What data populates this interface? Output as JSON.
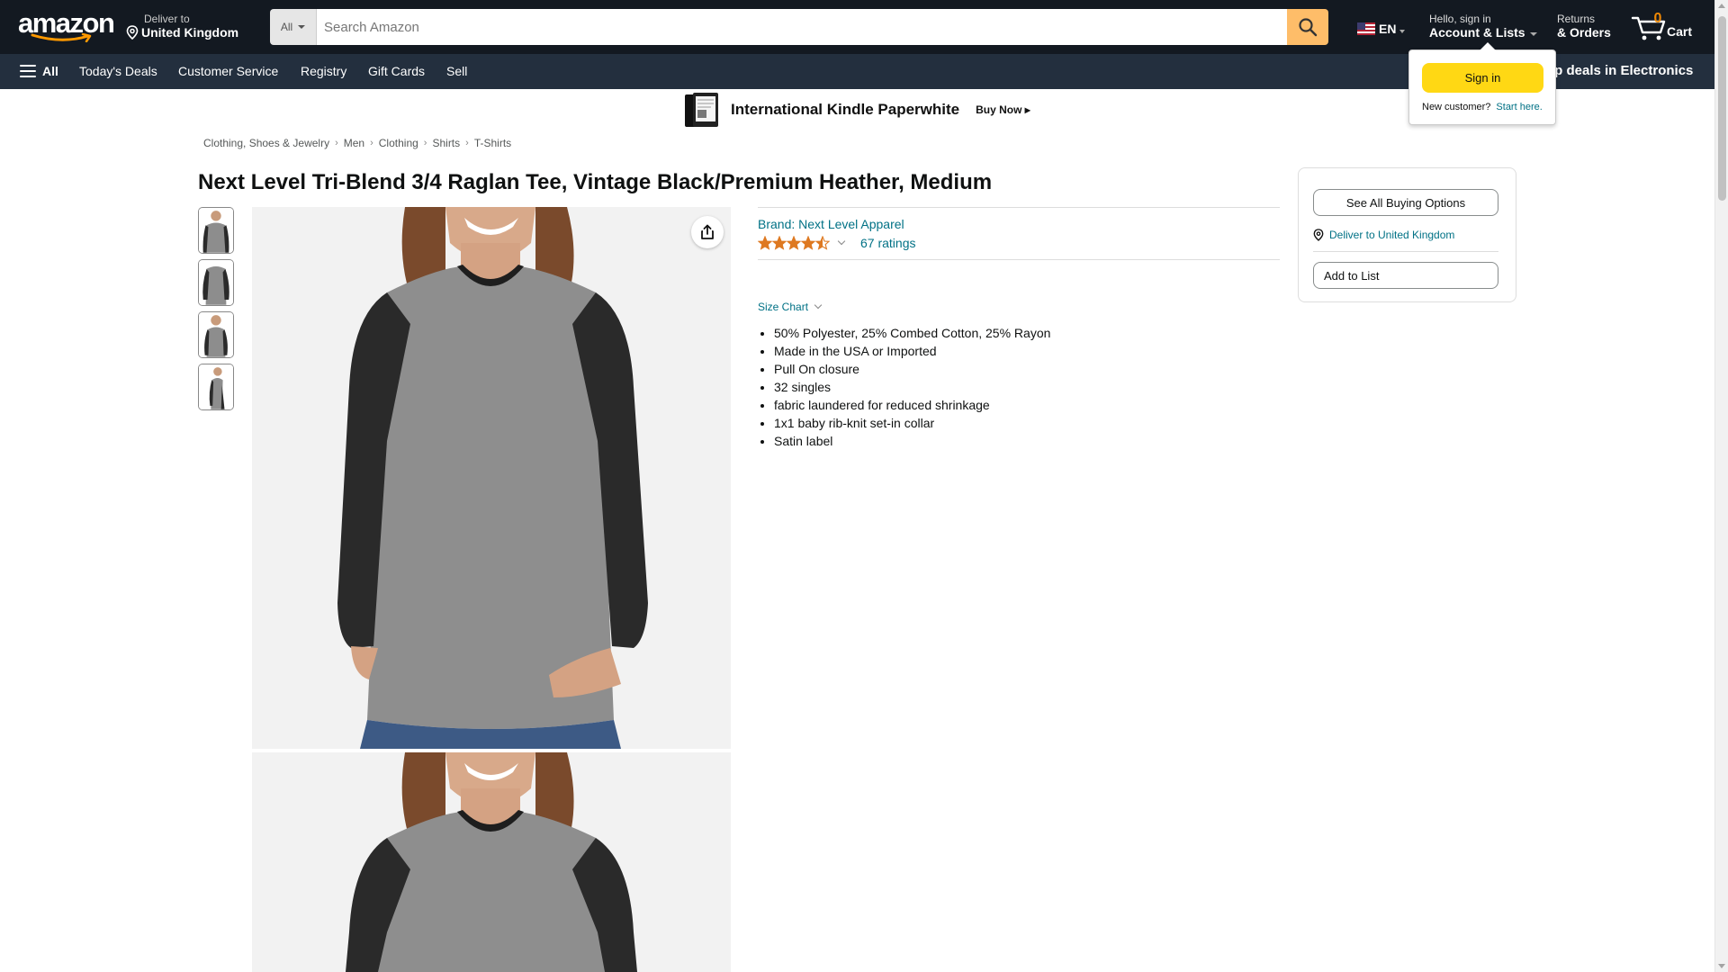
{
  "header": {
    "logo_text": "amazon",
    "deliver_line1": "Deliver to",
    "deliver_line2": "United Kingdom",
    "search_category": "All",
    "search_placeholder": "Search Amazon",
    "language": "EN",
    "account_line1": "Hello, sign in",
    "account_line2": "Account & Lists",
    "returns_line1": "Returns",
    "returns_line2": "& Orders",
    "cart_count": "0",
    "cart_label": "Cart"
  },
  "subnav": {
    "all_label": "All",
    "links": [
      "Today's Deals",
      "Customer Service",
      "Registry",
      "Gift Cards",
      "Sell"
    ],
    "promo": "op deals in Electronics"
  },
  "banner": {
    "title": "International Kindle Paperwhite",
    "cta": "Buy Now ▸"
  },
  "breadcrumb": [
    "Clothing, Shoes & Jewelry",
    "Men",
    "Clothing",
    "Shirts",
    "T-Shirts"
  ],
  "product": {
    "title": "Next Level Tri-Blend 3/4 Raglan Tee, Vintage Black/Premium Heather, Medium",
    "brand": "Brand: Next Level Apparel",
    "rating_value": 4.5,
    "ratings_count": "67 ratings",
    "size_chart": "Size Chart",
    "bullets": [
      "50% Polyester, 25% Combed Cotton, 25% Rayon",
      "Made in the USA or Imported",
      "Pull On closure",
      "32 singles",
      "fabric laundered for reduced shrinkage",
      "1x1 baby rib-knit set-in collar",
      "Satin label"
    ]
  },
  "buybox": {
    "see_options": "See All Buying Options",
    "deliver": "Deliver to United Kingdom",
    "add_to_list": "Add to List"
  },
  "signin_flyout": {
    "button": "Sign in",
    "new_customer": "New customer?",
    "start_here": "Start here."
  },
  "colors": {
    "nav_dark": "#131921",
    "nav_sub": "#232f3e",
    "search_button": "#febd69",
    "link": "#007185",
    "star": "#de7921",
    "signin_yellow": "#ffd814",
    "cart_count": "#f08804"
  }
}
